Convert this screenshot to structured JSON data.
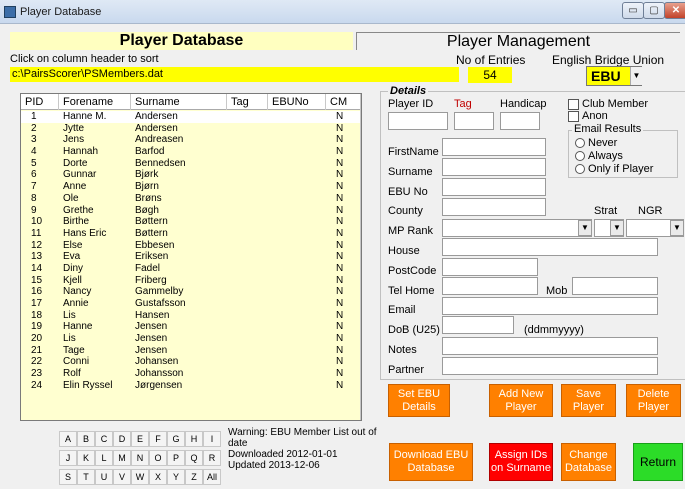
{
  "window": {
    "title": "Player Database",
    "min": "▭",
    "max": "▢",
    "close": "✕"
  },
  "header": {
    "left_title": "Player Database",
    "right_title": "Player Management",
    "sort_hint": "Click on column header to sort",
    "entries_label": "No of Entries",
    "entries_value": "54",
    "union_label": "English Bridge Union",
    "union_value": "EBU",
    "file_path": "c:\\PairsScorer\\PSMembers.dat"
  },
  "table": {
    "columns": [
      "PID",
      "Forename",
      "Surname",
      "Tag",
      "EBUNo",
      "CM"
    ],
    "rows": [
      {
        "pid": "1",
        "forename": "Hanne M.",
        "surname": "Andersen",
        "cm": "N"
      },
      {
        "pid": "2",
        "forename": "Jytte",
        "surname": "Andersen",
        "cm": "N"
      },
      {
        "pid": "3",
        "forename": "Jens",
        "surname": "Andreasen",
        "cm": "N"
      },
      {
        "pid": "4",
        "forename": "Hannah",
        "surname": "Barfod",
        "cm": "N"
      },
      {
        "pid": "5",
        "forename": "Dorte",
        "surname": "Bennedsen",
        "cm": "N"
      },
      {
        "pid": "6",
        "forename": "Gunnar",
        "surname": "Bjørk",
        "cm": "N"
      },
      {
        "pid": "7",
        "forename": "Anne",
        "surname": "Bjørn",
        "cm": "N"
      },
      {
        "pid": "8",
        "forename": "Ole",
        "surname": "Brøns",
        "cm": "N"
      },
      {
        "pid": "9",
        "forename": "Grethe",
        "surname": "Bøgh",
        "cm": "N"
      },
      {
        "pid": "10",
        "forename": "Birthe",
        "surname": "Bøttern",
        "cm": "N"
      },
      {
        "pid": "11",
        "forename": "Hans Eric",
        "surname": "Bøttern",
        "cm": "N"
      },
      {
        "pid": "12",
        "forename": "Else",
        "surname": "Ebbesen",
        "cm": "N"
      },
      {
        "pid": "13",
        "forename": "Eva",
        "surname": "Eriksen",
        "cm": "N"
      },
      {
        "pid": "14",
        "forename": "Diny",
        "surname": "Fadel",
        "cm": "N"
      },
      {
        "pid": "15",
        "forename": "Kjell",
        "surname": "Friberg",
        "cm": "N"
      },
      {
        "pid": "16",
        "forename": "Nancy",
        "surname": "Gammelby",
        "cm": "N"
      },
      {
        "pid": "17",
        "forename": "Annie",
        "surname": "Gustafsson",
        "cm": "N"
      },
      {
        "pid": "18",
        "forename": "Lis",
        "surname": "Hansen",
        "cm": "N"
      },
      {
        "pid": "19",
        "forename": "Hanne",
        "surname": "Jensen",
        "cm": "N"
      },
      {
        "pid": "20",
        "forename": "Lis",
        "surname": "Jensen",
        "cm": "N"
      },
      {
        "pid": "21",
        "forename": "Tage",
        "surname": "Jensen",
        "cm": "N"
      },
      {
        "pid": "22",
        "forename": "Conni",
        "surname": "Johansen",
        "cm": "N"
      },
      {
        "pid": "23",
        "forename": "Rolf",
        "surname": "Johansson",
        "cm": "N"
      },
      {
        "pid": "24",
        "forename": "Elin Ryssel",
        "surname": "Jørgensen",
        "cm": "N"
      }
    ]
  },
  "alphabet": [
    "A",
    "B",
    "C",
    "D",
    "E",
    "F",
    "G",
    "H",
    "I",
    "J",
    "K",
    "L",
    "M",
    "N",
    "O",
    "P",
    "Q",
    "R",
    "S",
    "T",
    "U",
    "V",
    "W",
    "X",
    "Y",
    "Z",
    "All"
  ],
  "warning": {
    "line1": "Warning: EBU Member List out of date",
    "line2": "Downloaded 2012-01-01",
    "line3": "Updated 2013-12-06"
  },
  "details": {
    "title": "Details",
    "player_id_label": "Player ID",
    "tag_label": "Tag",
    "handicap_label": "Handicap",
    "club_member_label": "Club Member",
    "anon_label": "Anon",
    "email_results_title": "Email Results",
    "email_options": [
      "Never",
      "Always",
      "Only if Player"
    ],
    "firstname_label": "FirstName",
    "surname_label": "Surname",
    "ebu_no_label": "EBU No",
    "county_label": "County",
    "strat_label": "Strat",
    "ngr_label": "NGR",
    "mp_rank_label": "MP Rank",
    "house_label": "House",
    "postcode_label": "PostCode",
    "tel_home_label": "Tel Home",
    "mob_label": "Mob",
    "email_label": "Email",
    "dob_label": "DoB (U25)",
    "dob_hint": "(ddmmyyyy)",
    "notes_label": "Notes",
    "partner_label": "Partner",
    "tag_color": "#c00000"
  },
  "buttons": {
    "set_ebu": [
      "Set EBU",
      "Details"
    ],
    "add_new": [
      "Add New",
      "Player"
    ],
    "save": [
      "Save",
      "Player"
    ],
    "delete": [
      "Delete",
      "Player"
    ],
    "download": [
      "Download EBU",
      "Database"
    ],
    "assign": [
      "Assign IDs",
      "on Surname"
    ],
    "change": [
      "Change",
      "Database"
    ],
    "return": "Return"
  },
  "colors": {
    "orange": "#ff8000",
    "red": "#ff0000",
    "green": "#2cdc28",
    "highlight": "#ffff00",
    "table_bg": "#ffffd0"
  }
}
